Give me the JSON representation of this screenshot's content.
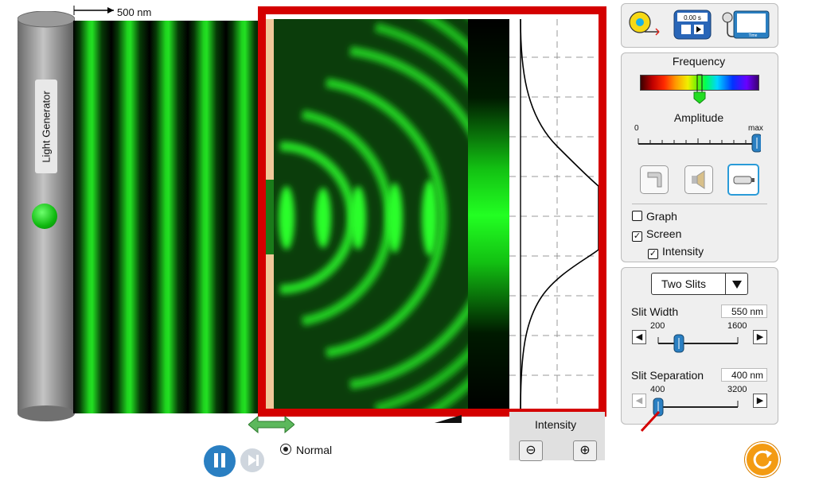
{
  "generator": {
    "label": "Light Generator"
  },
  "scale": {
    "label": "500 nm"
  },
  "controls": {
    "frequency_label": "Frequency",
    "amplitude_label": "Amplitude",
    "amplitude_min": "0",
    "amplitude_max": "max",
    "amplitude_level": 1.0,
    "frequency_level": 0.5,
    "checkboxes": [
      {
        "label": "Graph",
        "checked": false
      },
      {
        "label": "Screen",
        "checked": true
      },
      {
        "label": "Intensity",
        "checked": true
      }
    ]
  },
  "slits": {
    "mode": "Two Slits",
    "width_label": "Slit Width",
    "width_value": "550 nm",
    "width_min": "200",
    "width_max": "1600",
    "width_level": 0.25,
    "separation_label": "Slit Separation",
    "separation_value": "400 nm",
    "separation_min": "400",
    "separation_max": "3200",
    "separation_level": 0.0
  },
  "intensity": {
    "label": "Intensity"
  },
  "time": {
    "label": "Normal"
  },
  "tools": {
    "stopwatch_readout": "0.00 s",
    "probe_label": "Time"
  },
  "colors": {
    "beam": "#22e022",
    "frame": "#d40000",
    "slider": "#2a7fc2"
  }
}
